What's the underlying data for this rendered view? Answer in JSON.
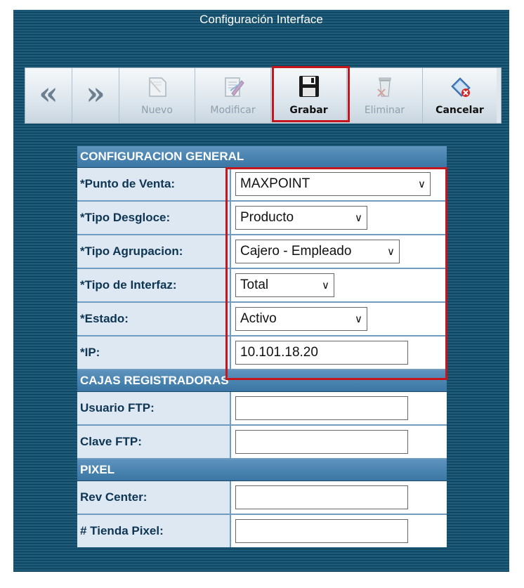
{
  "window": {
    "title": "Configuración Interface"
  },
  "toolbar": {
    "back_icon": "double-left-chevron-icon",
    "forward_icon": "double-right-chevron-icon",
    "buttons": [
      {
        "label": "Nuevo",
        "icon": "new-document-icon",
        "enabled": false
      },
      {
        "label": "Modificar",
        "icon": "edit-document-icon",
        "enabled": false
      },
      {
        "label": "Grabar",
        "icon": "floppy-disk-icon",
        "enabled": true,
        "highlighted": true
      },
      {
        "label": "Eliminar",
        "icon": "trash-can-icon",
        "enabled": false
      },
      {
        "label": "Cancelar",
        "icon": "cancel-document-icon",
        "enabled": true
      }
    ]
  },
  "sections": {
    "general": "CONFIGURACION GENERAL",
    "cajas": "CAJAS REGISTRADORAS",
    "pixel": "PIXEL"
  },
  "fields": {
    "punto_venta": {
      "label": "*Punto de Venta:",
      "value": "MAXPOINT"
    },
    "tipo_desgloce": {
      "label": "*Tipo Desgloce:",
      "value": "Producto"
    },
    "tipo_agrupacion": {
      "label": "*Tipo Agrupacion:",
      "value": "Cajero - Empleado"
    },
    "tipo_interfaz": {
      "label": "*Tipo de Interfaz:",
      "value": "Total"
    },
    "estado": {
      "label": "*Estado:",
      "value": "Activo"
    },
    "ip": {
      "label": "*IP:",
      "value": "10.101.18.20"
    },
    "usuario_ftp": {
      "label": "Usuario FTP:",
      "value": ""
    },
    "clave_ftp": {
      "label": "Clave FTP:",
      "value": ""
    },
    "rev_center": {
      "label": "Rev Center:",
      "value": ""
    },
    "tienda_pixel": {
      "label": "# Tienda Pixel:",
      "value": ""
    }
  },
  "colors": {
    "highlight": "#c4161c",
    "section_header": "#3a76a4",
    "label_bg": "#dde8f3"
  }
}
